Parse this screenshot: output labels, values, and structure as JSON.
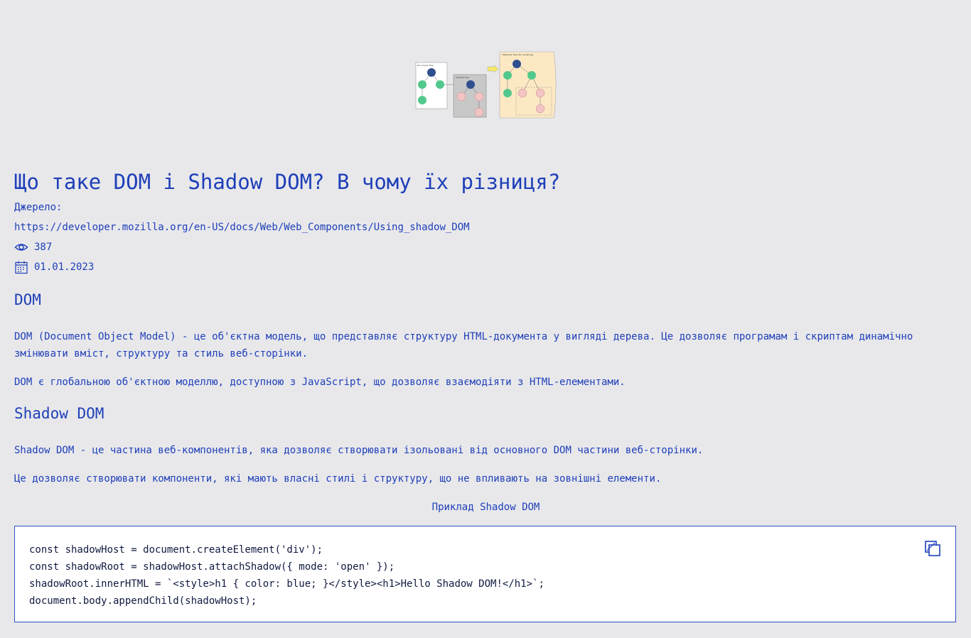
{
  "article": {
    "title": "Що таке DOM і Shadow DOM? В чому їх різниця?",
    "source_label": "Джерело:",
    "source_url": "https://developer.mozilla.org/en-US/docs/Web/Web_Components/Using_shadow_DOM",
    "views": "387",
    "date": "01.01.2023"
  },
  "hero_image": {
    "labels": [
      "Document Tree",
      "Shadow Tree",
      "Flattened Tree (for rendering)"
    ]
  },
  "sections": [
    {
      "heading": "DOM",
      "paragraphs": [
        "DOM (Document Object Model) - це об'єктна модель, що представляє структуру HTML-документа у вигляді дерева. Це дозволяє програмам і скриптам динамічно змінювати вміст, структуру та стиль веб-сторінки.",
        "DOM є глобальною об'єктною моделлю, доступною з JavaScript, що дозволяє взаємодіяти з HTML-елементами."
      ]
    },
    {
      "heading": "Shadow DOM",
      "paragraphs": [
        "Shadow DOM - це частина веб-компонентів, яка дозволяє створювати ізольовані від основного DOM частини веб-сторінки.",
        "Це дозволяє створювати компоненти, які мають власні стилі і структуру, що не впливають на зовнішні елементи."
      ]
    }
  ],
  "example": {
    "caption": "Приклад Shadow DOM",
    "code_lines": [
      "const shadowHost = document.createElement('div');",
      "const shadowRoot = shadowHost.attachShadow({ mode: 'open' });",
      "shadowRoot.innerHTML = `<style>h1 { color: blue; }</style><h1>Hello Shadow DOM!</h1>`;",
      "document.body.appendChild(shadowHost);"
    ]
  },
  "icons": {
    "views": "eye-icon",
    "date": "calendar-icon",
    "copy": "copy-icon"
  },
  "colors": {
    "background": "#e8e8eb",
    "text": "#1e3fb8",
    "code_border": "#2a4fc4"
  }
}
